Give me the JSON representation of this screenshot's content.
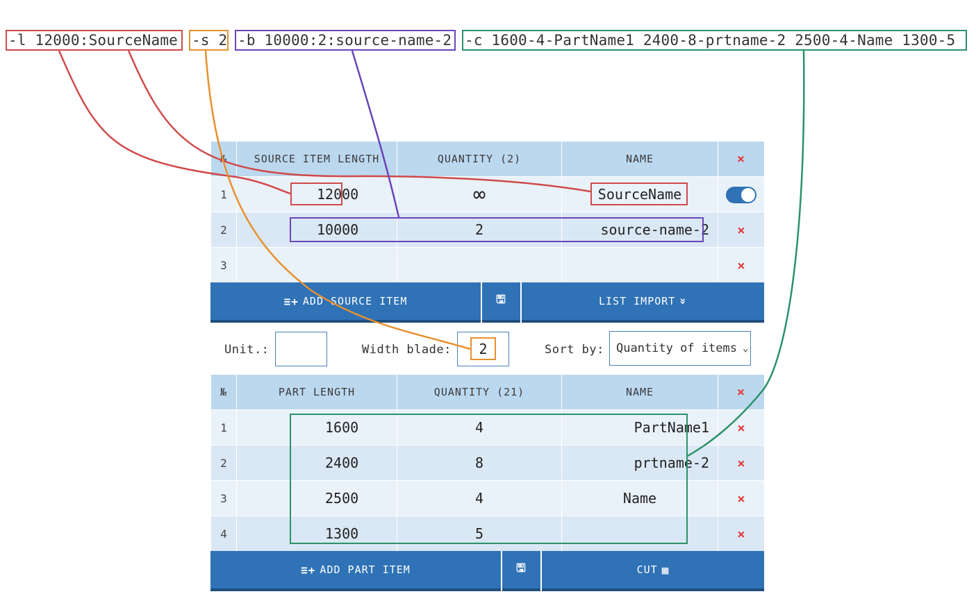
{
  "commands": {
    "l": "-l 12000:SourceName",
    "s": "-s 2",
    "b": "-b 10000:2:source-name-2",
    "c": "-c 1600-4-PartName1 2400-8-prtname-2 2500-4-Name 1300-5"
  },
  "source_table": {
    "headers": {
      "num": "№",
      "length": "SOURCE ITEM LENGTH",
      "quantity": "QUANTITY (2)",
      "name": "NAME",
      "delete": "×"
    },
    "rows": [
      {
        "num": "1",
        "length": "12000",
        "quantity": "∞",
        "name": "SourceName",
        "toggle": "on"
      },
      {
        "num": "2",
        "length": "10000",
        "quantity": "2",
        "name": "source-name-2",
        "delete": "×"
      },
      {
        "num": "3",
        "length": "",
        "quantity": "",
        "name": "",
        "delete": "×"
      }
    ]
  },
  "source_bar": {
    "add_label": "ADD SOURCE ITEM",
    "add_icon": "≡+",
    "save_icon": "🖫",
    "import_label": "LIST IMPORT",
    "import_icon": "»"
  },
  "settings": {
    "unit_label": "Unit.:",
    "unit_value": "",
    "blade_label": "Width blade:",
    "blade_value": "2",
    "sort_label": "Sort by:",
    "sort_value": "Quantity of items",
    "sort_chevron": "⌄"
  },
  "parts_table": {
    "headers": {
      "num": "№",
      "length": "PART LENGTH",
      "quantity": "QUANTITY (21)",
      "name": "NAME",
      "delete": "×"
    },
    "rows": [
      {
        "num": "1",
        "length": "1600",
        "quantity": "4",
        "name": "PartName1",
        "delete": "×"
      },
      {
        "num": "2",
        "length": "2400",
        "quantity": "8",
        "name": "prtname-2",
        "delete": "×"
      },
      {
        "num": "3",
        "length": "2500",
        "quantity": "4",
        "name": "Name",
        "delete": "×"
      },
      {
        "num": "4",
        "length": "1300",
        "quantity": "5",
        "name": "",
        "delete": "×"
      }
    ]
  },
  "parts_bar": {
    "add_label": "ADD PART ITEM",
    "add_icon": "≡+",
    "save_icon": "🖫",
    "cut_label": "CUT",
    "cut_icon": "▦"
  },
  "colors": {
    "red": "#d04a4a",
    "orange": "#e8902e",
    "purple": "#6a44b8",
    "green": "#2a9268",
    "button_blue": "#2f72b6",
    "header_blue": "#bcd8ef"
  }
}
